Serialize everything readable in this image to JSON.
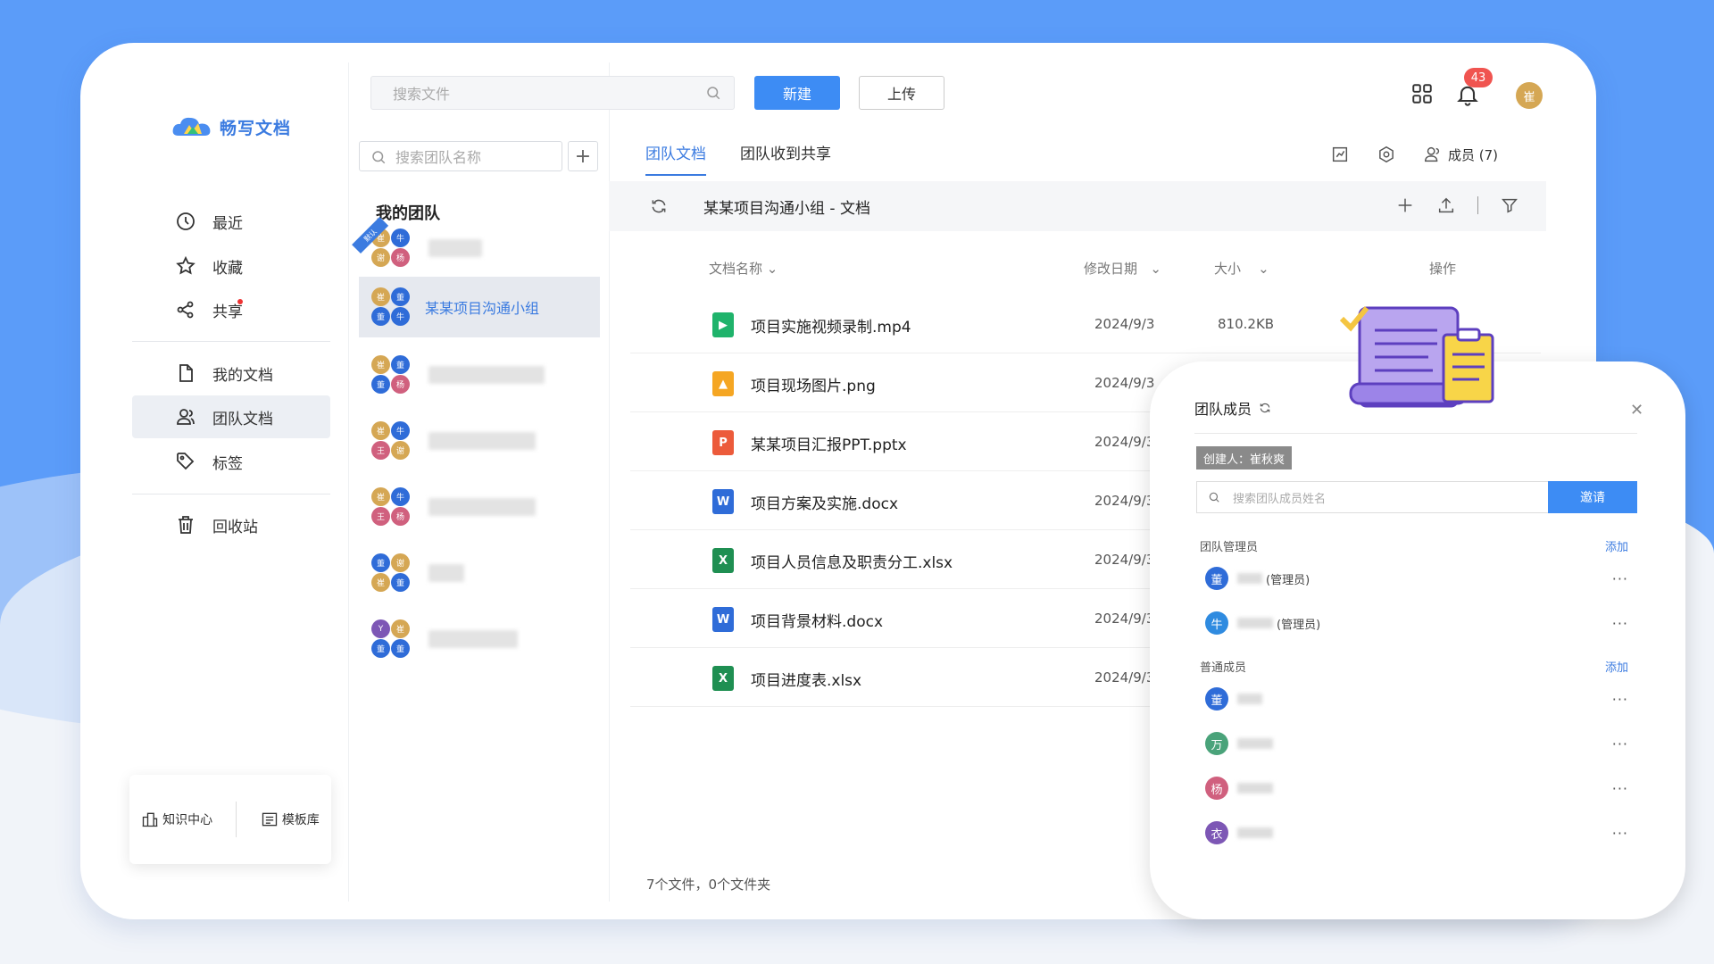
{
  "app": {
    "logo_text": "畅写文档"
  },
  "search_files": {
    "placeholder": "搜索文件"
  },
  "toolbar": {
    "new_label": "新建",
    "upload_label": "上传"
  },
  "notifications": {
    "count": "43"
  },
  "user": {
    "avatar_text": "崔"
  },
  "nav": {
    "recent": "最近",
    "favorites": "收藏",
    "shared": "共享",
    "my_docs": "我的文档",
    "team_docs": "团队文档",
    "tags": "标签",
    "recycle": "回收站"
  },
  "bottom": {
    "knowledge": "知识中心",
    "templates": "模板库"
  },
  "teams": {
    "search_placeholder": "搜索团队名称",
    "add": "+",
    "title": "我的团队",
    "default_ribbon": "默认",
    "active_team_name": "某某项目沟通小组",
    "rows": [
      {
        "avatars": [
          "崔",
          "牛",
          "谢",
          "杨"
        ]
      },
      {
        "avatars": [
          "崔",
          "董",
          "董",
          "牛"
        ]
      },
      {
        "avatars": [
          "崔",
          "董",
          "董",
          "杨"
        ]
      },
      {
        "avatars": [
          "崔",
          "牛",
          "王",
          "谢"
        ]
      },
      {
        "avatars": [
          "崔",
          "牛",
          "王",
          "杨"
        ]
      },
      {
        "avatars": [
          "董",
          "谢",
          "崔",
          "董"
        ]
      },
      {
        "avatars": [
          "Y",
          "崔",
          "董",
          "董"
        ]
      }
    ]
  },
  "tabs": {
    "team_docs": "团队文档",
    "team_received": "团队收到共享",
    "members": "成员 (7)"
  },
  "breadcrumb": {
    "title": "某某项目沟通小组 - 文档"
  },
  "table": {
    "headers": {
      "name": "文档名称",
      "modified": "修改日期",
      "size": "大小",
      "actions": "操作"
    },
    "rows": [
      {
        "name": "项目实施视频录制.mp4",
        "date": "2024/9/3",
        "size": "810.2KB",
        "type": "video",
        "icon_label": "▶",
        "color": "#1fb36b"
      },
      {
        "name": "项目现场图片.png",
        "date": "2024/9/3",
        "size": "",
        "type": "image",
        "icon_label": "▲",
        "color": "#f5a623"
      },
      {
        "name": "某某项目汇报PPT.pptx",
        "date": "2024/9/3",
        "size": "",
        "type": "ppt",
        "icon_label": "P",
        "color": "#ec5b3b"
      },
      {
        "name": "项目方案及实施.docx",
        "date": "2024/9/3",
        "size": "",
        "type": "word",
        "icon_label": "W",
        "color": "#2f6cd8"
      },
      {
        "name": "项目人员信息及职责分工.xlsx",
        "date": "2024/9/3",
        "size": "",
        "type": "excel",
        "icon_label": "X",
        "color": "#1f8f52"
      },
      {
        "name": "项目背景材料.docx",
        "date": "2024/9/3",
        "size": "",
        "type": "word",
        "icon_label": "W",
        "color": "#2f6cd8"
      },
      {
        "name": "项目进度表.xlsx",
        "date": "2024/9/3",
        "size": "",
        "type": "excel",
        "icon_label": "X",
        "color": "#1f8f52"
      }
    ],
    "footer": "7个文件，0个文件夹"
  },
  "members": {
    "title": "团队成员",
    "creator": "创建人：崔秋爽",
    "search_placeholder": "搜索团队成员姓名",
    "invite": "邀请",
    "admins_title": "团队管理员",
    "regular_title": "普通成员",
    "add_label": "添加",
    "admin_role": "(管理员)",
    "admins": [
      {
        "avatar": "董",
        "color": "#2f6cd8"
      },
      {
        "avatar": "牛",
        "color": "#2f8be0"
      }
    ],
    "regular": [
      {
        "avatar": "董",
        "color": "#2f6cd8"
      },
      {
        "avatar": "万",
        "color": "#4aa37a"
      },
      {
        "avatar": "杨",
        "color": "#d0607e"
      },
      {
        "avatar": "衣",
        "color": "#7d57b5"
      }
    ],
    "more": "···"
  },
  "colors": {
    "accent": "#3d8cf4",
    "background": "#5b9cf9",
    "badge": "#f05450"
  }
}
